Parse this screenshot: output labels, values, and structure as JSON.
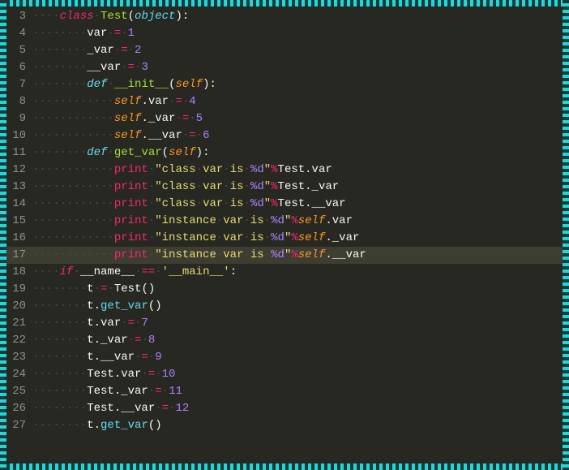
{
  "editor": {
    "active_line": 17,
    "lines": [
      {
        "n": 3,
        "tokens": [
          [
            "ws",
            "····"
          ],
          [
            "kw",
            "class"
          ],
          [
            "ws",
            "·"
          ],
          [
            "cls",
            "Test"
          ],
          [
            "var",
            "("
          ],
          [
            "kw2",
            "object"
          ],
          [
            "var",
            "):"
          ]
        ]
      },
      {
        "n": 4,
        "tokens": [
          [
            "ws",
            "········"
          ],
          [
            "var",
            "var"
          ],
          [
            "ws",
            "·"
          ],
          [
            "op",
            "="
          ],
          [
            "ws",
            "·"
          ],
          [
            "num",
            "1"
          ]
        ]
      },
      {
        "n": 5,
        "tokens": [
          [
            "ws",
            "········"
          ],
          [
            "var",
            "_var"
          ],
          [
            "ws",
            "·"
          ],
          [
            "op",
            "="
          ],
          [
            "ws",
            "·"
          ],
          [
            "num",
            "2"
          ]
        ]
      },
      {
        "n": 6,
        "tokens": [
          [
            "ws",
            "········"
          ],
          [
            "var",
            "__var"
          ],
          [
            "ws",
            "·"
          ],
          [
            "op",
            "="
          ],
          [
            "ws",
            "·"
          ],
          [
            "num",
            "3"
          ]
        ]
      },
      {
        "n": 7,
        "tokens": [
          [
            "ws",
            "········"
          ],
          [
            "kw2",
            "def"
          ],
          [
            "ws",
            "·"
          ],
          [
            "fn",
            "__init__"
          ],
          [
            "var",
            "("
          ],
          [
            "param",
            "self"
          ],
          [
            "var",
            "):"
          ]
        ]
      },
      {
        "n": 8,
        "tokens": [
          [
            "ws",
            "············"
          ],
          [
            "param",
            "self"
          ],
          [
            "var",
            ".var"
          ],
          [
            "ws",
            "·"
          ],
          [
            "op",
            "="
          ],
          [
            "ws",
            "·"
          ],
          [
            "num",
            "4"
          ]
        ]
      },
      {
        "n": 9,
        "tokens": [
          [
            "ws",
            "············"
          ],
          [
            "param",
            "self"
          ],
          [
            "var",
            "._var"
          ],
          [
            "ws",
            "·"
          ],
          [
            "op",
            "="
          ],
          [
            "ws",
            "·"
          ],
          [
            "num",
            "5"
          ]
        ]
      },
      {
        "n": 10,
        "tokens": [
          [
            "ws",
            "············"
          ],
          [
            "param",
            "self"
          ],
          [
            "var",
            ".__var"
          ],
          [
            "ws",
            "·"
          ],
          [
            "op",
            "="
          ],
          [
            "ws",
            "·"
          ],
          [
            "num",
            "6"
          ]
        ]
      },
      {
        "n": 11,
        "tokens": [
          [
            "ws",
            "········"
          ],
          [
            "kw2",
            "def"
          ],
          [
            "ws",
            "·"
          ],
          [
            "fn",
            "get_var"
          ],
          [
            "var",
            "("
          ],
          [
            "param",
            "self"
          ],
          [
            "var",
            "):"
          ]
        ]
      },
      {
        "n": 12,
        "tokens": [
          [
            "ws",
            "············"
          ],
          [
            "op",
            "print"
          ],
          [
            "ws",
            "·"
          ],
          [
            "str",
            "\"class"
          ],
          [
            "ws",
            "·"
          ],
          [
            "str",
            "var"
          ],
          [
            "ws",
            "·"
          ],
          [
            "str",
            "is"
          ],
          [
            "ws",
            "·"
          ],
          [
            "num",
            "%d"
          ],
          [
            "str",
            "\""
          ],
          [
            "op",
            "%"
          ],
          [
            "var",
            "Test.var"
          ]
        ]
      },
      {
        "n": 13,
        "tokens": [
          [
            "ws",
            "············"
          ],
          [
            "op",
            "print"
          ],
          [
            "ws",
            "·"
          ],
          [
            "str",
            "\"class"
          ],
          [
            "ws",
            "·"
          ],
          [
            "str",
            "var"
          ],
          [
            "ws",
            "·"
          ],
          [
            "str",
            "is"
          ],
          [
            "ws",
            "·"
          ],
          [
            "num",
            "%d"
          ],
          [
            "str",
            "\""
          ],
          [
            "op",
            "%"
          ],
          [
            "var",
            "Test._var"
          ]
        ]
      },
      {
        "n": 14,
        "tokens": [
          [
            "ws",
            "············"
          ],
          [
            "op",
            "print"
          ],
          [
            "ws",
            "·"
          ],
          [
            "str",
            "\"class"
          ],
          [
            "ws",
            "·"
          ],
          [
            "str",
            "var"
          ],
          [
            "ws",
            "·"
          ],
          [
            "str",
            "is"
          ],
          [
            "ws",
            "·"
          ],
          [
            "num",
            "%d"
          ],
          [
            "str",
            "\""
          ],
          [
            "op",
            "%"
          ],
          [
            "var",
            "Test.__var"
          ]
        ]
      },
      {
        "n": 15,
        "tokens": [
          [
            "ws",
            "············"
          ],
          [
            "op",
            "print"
          ],
          [
            "ws",
            "·"
          ],
          [
            "str",
            "\"instance"
          ],
          [
            "ws",
            "·"
          ],
          [
            "str",
            "var"
          ],
          [
            "ws",
            "·"
          ],
          [
            "str",
            "is"
          ],
          [
            "ws",
            "·"
          ],
          [
            "num",
            "%d"
          ],
          [
            "str",
            "\""
          ],
          [
            "op",
            "%"
          ],
          [
            "param",
            "self"
          ],
          [
            "var",
            ".var"
          ]
        ]
      },
      {
        "n": 16,
        "tokens": [
          [
            "ws",
            "············"
          ],
          [
            "op",
            "print"
          ],
          [
            "ws",
            "·"
          ],
          [
            "str",
            "\"instance"
          ],
          [
            "ws",
            "·"
          ],
          [
            "str",
            "var"
          ],
          [
            "ws",
            "·"
          ],
          [
            "str",
            "is"
          ],
          [
            "ws",
            "·"
          ],
          [
            "num",
            "%d"
          ],
          [
            "str",
            "\""
          ],
          [
            "op",
            "%"
          ],
          [
            "param",
            "self"
          ],
          [
            "var",
            "._var"
          ]
        ]
      },
      {
        "n": 17,
        "tokens": [
          [
            "ws",
            "············"
          ],
          [
            "op",
            "print"
          ],
          [
            "ws",
            "·"
          ],
          [
            "str",
            "\"instance"
          ],
          [
            "ws",
            "·"
          ],
          [
            "str",
            "var"
          ],
          [
            "ws",
            "·"
          ],
          [
            "str",
            "is"
          ],
          [
            "ws",
            "·"
          ],
          [
            "num",
            "%d"
          ],
          [
            "str",
            "\""
          ],
          [
            "op",
            "%"
          ],
          [
            "param",
            "self"
          ],
          [
            "var",
            ".__var"
          ]
        ]
      },
      {
        "n": 18,
        "tokens": [
          [
            "ws",
            "····"
          ],
          [
            "kw",
            "if"
          ],
          [
            "ws",
            "·"
          ],
          [
            "var",
            "__name__"
          ],
          [
            "ws",
            "·"
          ],
          [
            "op",
            "=="
          ],
          [
            "ws",
            "·"
          ],
          [
            "str",
            "'__main__'"
          ],
          [
            "var",
            ":"
          ]
        ]
      },
      {
        "n": 19,
        "tokens": [
          [
            "ws",
            "········"
          ],
          [
            "var",
            "t"
          ],
          [
            "ws",
            "·"
          ],
          [
            "op",
            "="
          ],
          [
            "ws",
            "·"
          ],
          [
            "var",
            "Test()"
          ]
        ]
      },
      {
        "n": 20,
        "tokens": [
          [
            "ws",
            "········"
          ],
          [
            "var",
            "t."
          ],
          [
            "call",
            "get_var"
          ],
          [
            "var",
            "()"
          ]
        ]
      },
      {
        "n": 21,
        "tokens": [
          [
            "ws",
            "········"
          ],
          [
            "var",
            "t.var"
          ],
          [
            "ws",
            "·"
          ],
          [
            "op",
            "="
          ],
          [
            "ws",
            "·"
          ],
          [
            "num",
            "7"
          ]
        ]
      },
      {
        "n": 22,
        "tokens": [
          [
            "ws",
            "········"
          ],
          [
            "var",
            "t._var"
          ],
          [
            "ws",
            "·"
          ],
          [
            "op",
            "="
          ],
          [
            "ws",
            "·"
          ],
          [
            "num",
            "8"
          ]
        ]
      },
      {
        "n": 23,
        "tokens": [
          [
            "ws",
            "········"
          ],
          [
            "var",
            "t.__var"
          ],
          [
            "ws",
            "·"
          ],
          [
            "op",
            "="
          ],
          [
            "ws",
            "·"
          ],
          [
            "num",
            "9"
          ]
        ]
      },
      {
        "n": 24,
        "tokens": [
          [
            "ws",
            "········"
          ],
          [
            "var",
            "Test.var"
          ],
          [
            "ws",
            "·"
          ],
          [
            "op",
            "="
          ],
          [
            "ws",
            "·"
          ],
          [
            "num",
            "10"
          ]
        ]
      },
      {
        "n": 25,
        "tokens": [
          [
            "ws",
            "········"
          ],
          [
            "var",
            "Test._var"
          ],
          [
            "ws",
            "·"
          ],
          [
            "op",
            "="
          ],
          [
            "ws",
            "·"
          ],
          [
            "num",
            "11"
          ]
        ]
      },
      {
        "n": 26,
        "tokens": [
          [
            "ws",
            "········"
          ],
          [
            "var",
            "Test.__var"
          ],
          [
            "ws",
            "·"
          ],
          [
            "op",
            "="
          ],
          [
            "ws",
            "·"
          ],
          [
            "num",
            "12"
          ]
        ]
      },
      {
        "n": 27,
        "tokens": [
          [
            "ws",
            "········"
          ],
          [
            "var",
            "t."
          ],
          [
            "call",
            "get_var"
          ],
          [
            "var",
            "()"
          ]
        ]
      }
    ]
  }
}
